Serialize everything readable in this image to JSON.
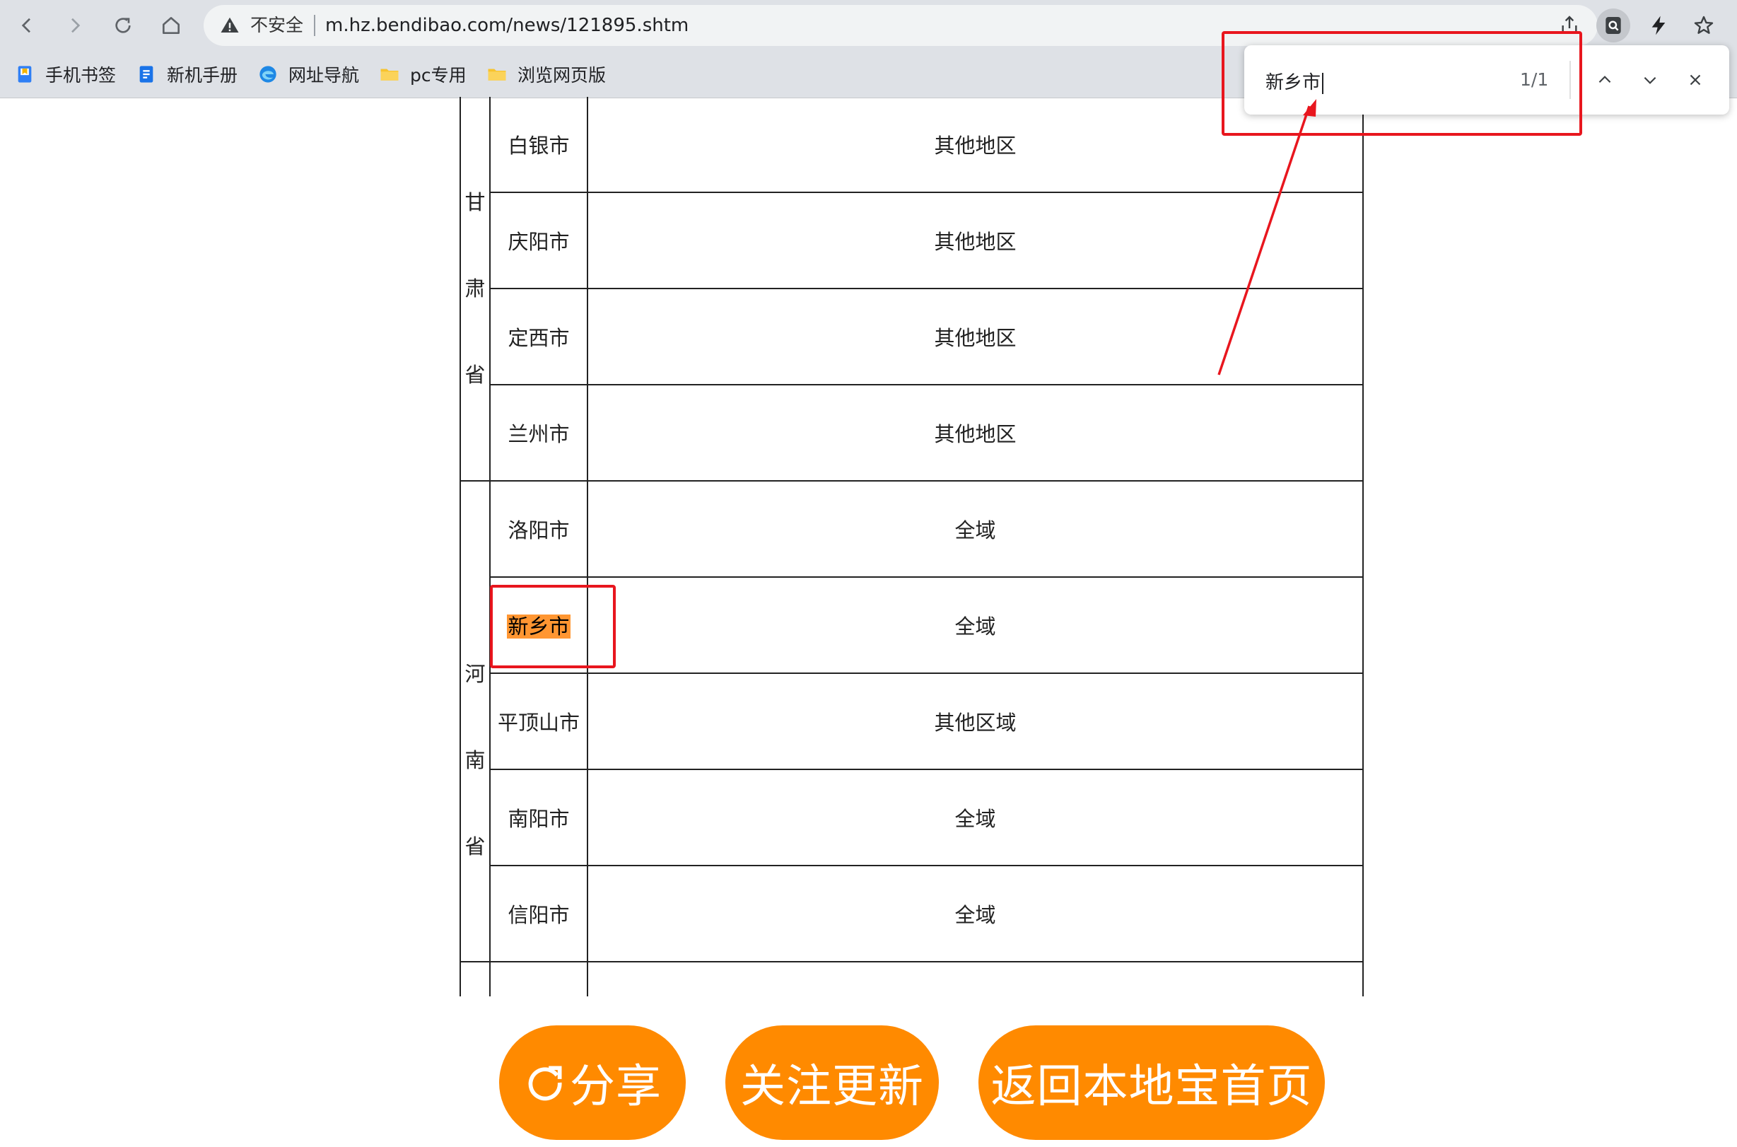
{
  "browser": {
    "security_label": "不安全",
    "url": "m.hz.bendibao.com/news/121895.shtm"
  },
  "bookmarks": [
    {
      "label": "手机书签",
      "icon": "bookmark-doc-icon"
    },
    {
      "label": "新机手册",
      "icon": "manual-icon"
    },
    {
      "label": "网址导航",
      "icon": "edge-icon"
    },
    {
      "label": "pc专用",
      "icon": "folder-icon"
    },
    {
      "label": "浏览网页版",
      "icon": "folder-icon"
    }
  ],
  "find": {
    "query": "新乡市",
    "count": "1/1"
  },
  "table": {
    "groups": [
      {
        "province_chars": [
          "甘",
          "肃",
          "省"
        ],
        "rows": [
          {
            "city": "白银市",
            "scope": "其他地区"
          },
          {
            "city": "庆阳市",
            "scope": "其他地区"
          },
          {
            "city": "定西市",
            "scope": "其他地区"
          },
          {
            "city": "兰州市",
            "scope": "其他地区"
          }
        ]
      },
      {
        "province_chars": [
          "河",
          "南",
          "省"
        ],
        "rows": [
          {
            "city": "洛阳市",
            "scope": "全域"
          },
          {
            "city": "新乡市",
            "scope": "全域"
          },
          {
            "city": "平顶山市",
            "scope": "其他区域"
          },
          {
            "city": "南阳市",
            "scope": "全域"
          },
          {
            "city": "信阳市",
            "scope": "全域"
          }
        ]
      }
    ]
  },
  "actions": {
    "share": "分享",
    "follow": "关注更新",
    "home": "返回本地宝首页"
  },
  "colors": {
    "accent_orange": "#ff8a00",
    "find_highlight": "#ff9632",
    "annotation_red": "#e8161e"
  }
}
